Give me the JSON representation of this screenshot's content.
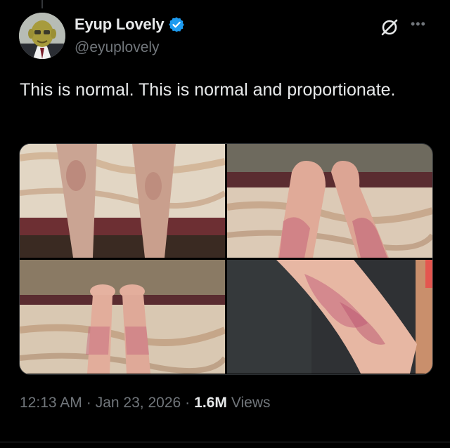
{
  "author": {
    "display_name": "Eyup Lovely",
    "handle": "@eyuplovely",
    "verified": true,
    "verified_color": "#1d9bf0"
  },
  "tweet": {
    "text": "This is normal. This is normal and proportionate.",
    "time": "12:13 AM",
    "date": "Jan 23, 2026",
    "views_count": "1.6M",
    "views_label": "Views"
  },
  "media": [
    {
      "icon": "photo-legs-on-towel"
    },
    {
      "icon": "photo-feet-rash"
    },
    {
      "icon": "photo-hands-rash"
    },
    {
      "icon": "photo-leg-closeup-rash"
    }
  ],
  "icons": {
    "grok": "grok-icon",
    "more": "more-icon",
    "verified": "verified-badge-icon"
  },
  "colors": {
    "background": "#000000",
    "text_primary": "#e7e9ea",
    "text_secondary": "#71767b",
    "accent": "#1d9bf0"
  }
}
